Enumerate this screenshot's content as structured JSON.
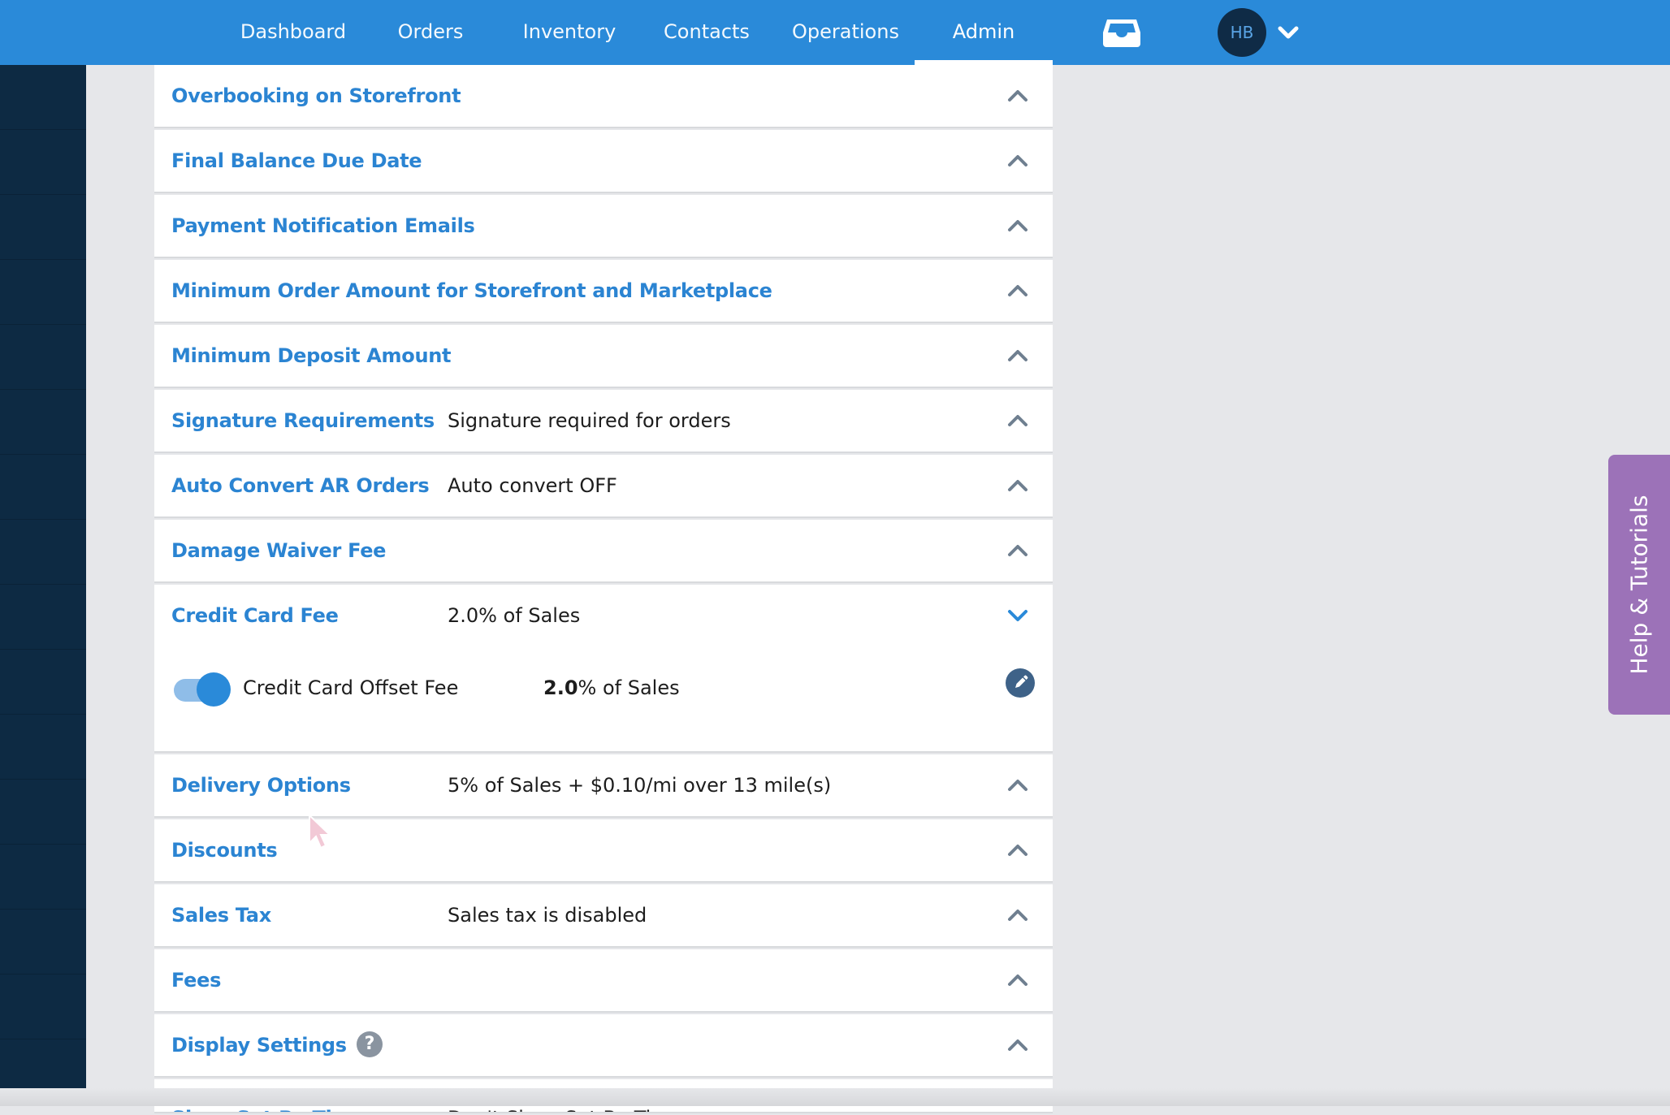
{
  "nav": {
    "items": [
      {
        "label": "Dashboard"
      },
      {
        "label": "Orders"
      },
      {
        "label": "Inventory"
      },
      {
        "label": "Contacts"
      },
      {
        "label": "Operations"
      },
      {
        "label": "Admin"
      }
    ],
    "active": "Admin",
    "avatar_initials": "HB"
  },
  "settings": {
    "rows": [
      {
        "title": "Overbooking on Storefront",
        "summary": ""
      },
      {
        "title": "Final Balance Due Date",
        "summary": ""
      },
      {
        "title": "Payment Notification Emails",
        "summary": ""
      },
      {
        "title": "Minimum Order Amount for Storefront and Marketplace",
        "summary": ""
      },
      {
        "title": "Minimum Deposit Amount",
        "summary": ""
      },
      {
        "title": "Signature Requirements",
        "summary": "Signature required for orders"
      },
      {
        "title": "Auto Convert AR Orders",
        "summary": "Auto convert OFF"
      },
      {
        "title": "Damage Waiver Fee",
        "summary": ""
      },
      {
        "title": "Credit Card Fee",
        "summary": "2.0% of Sales"
      },
      {
        "title": "Delivery Options",
        "summary": "5% of Sales + $0.10/mi over 13 mile(s)"
      },
      {
        "title": "Discounts",
        "summary": ""
      },
      {
        "title": "Sales Tax",
        "summary": "Sales tax is disabled"
      },
      {
        "title": "Fees",
        "summary": ""
      },
      {
        "title": "Display Settings",
        "summary": ""
      },
      {
        "title": "Show Set By Time",
        "summary": "Don't Show Set By Time"
      }
    ],
    "credit_card_detail": {
      "toggle_on": true,
      "label": "Credit Card Offset Fee",
      "value_bold": "2.0",
      "value_suffix": "% of Sales"
    },
    "display_settings_help": "?"
  },
  "help_tab": {
    "label": "Help & Tutorials"
  },
  "colors": {
    "nav": "#2a8ad9",
    "sidebar": "#0d2a43",
    "row_title": "#2b84d2",
    "help_tab": "#9c72b8"
  },
  "icons": [
    "inbox-icon",
    "chevron-down-icon",
    "chevron-up-icon",
    "pencil-icon",
    "question-icon",
    "mouse-cursor-icon"
  ]
}
